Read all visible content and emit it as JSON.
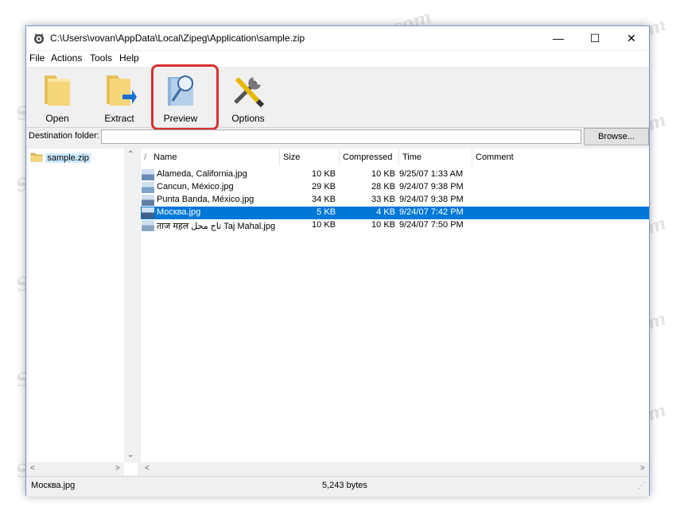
{
  "window": {
    "title": "C:\\Users\\vovan\\AppData\\Local\\Zipeg\\Application\\sample.zip",
    "minimize_glyph": "—",
    "maximize_glyph": "☐",
    "close_glyph": "✕"
  },
  "menu": [
    "File",
    "Actions",
    "Tools",
    "Help"
  ],
  "toolbar": {
    "open": "Open",
    "extract": "Extract",
    "preview": "Preview",
    "options": "Options"
  },
  "destination": {
    "label": "Destination folder:",
    "value": "",
    "browse": "Browse..."
  },
  "tree": {
    "root": "sample.zip"
  },
  "columns": {
    "sort": "/",
    "name": "Name",
    "size": "Size",
    "compressed": "Compressed",
    "time": "Time",
    "comment": "Comment"
  },
  "files": [
    {
      "name": "Alameda, California.jpg",
      "size": "10 KB",
      "compressed": "10 KB",
      "time": "9/25/07 1:33 AM",
      "selected": false
    },
    {
      "name": "Cancun, México.jpg",
      "size": "29 KB",
      "compressed": "28 KB",
      "time": "9/24/07 9:38 PM",
      "selected": false
    },
    {
      "name": "Punta Banda, México.jpg",
      "size": "34 KB",
      "compressed": "33 KB",
      "time": "9/24/07 9:38 PM",
      "selected": false
    },
    {
      "name": "Москва.jpg",
      "size": "5 KB",
      "compressed": "4 KB",
      "time": "9/24/07 7:42 PM",
      "selected": true
    },
    {
      "name": "ताज महल تاج محل Taj Mahal.jpg",
      "size": "10 KB",
      "compressed": "10 KB",
      "time": "9/24/07 7:50 PM",
      "selected": false
    }
  ],
  "status": {
    "file": "Москва.jpg",
    "bytes": "5,243 bytes"
  },
  "watermark": "Soringpcrepair.com",
  "colors": {
    "selection": "#0078d7",
    "highlight_frame": "#d8312f",
    "folder": "#f5d77a"
  }
}
